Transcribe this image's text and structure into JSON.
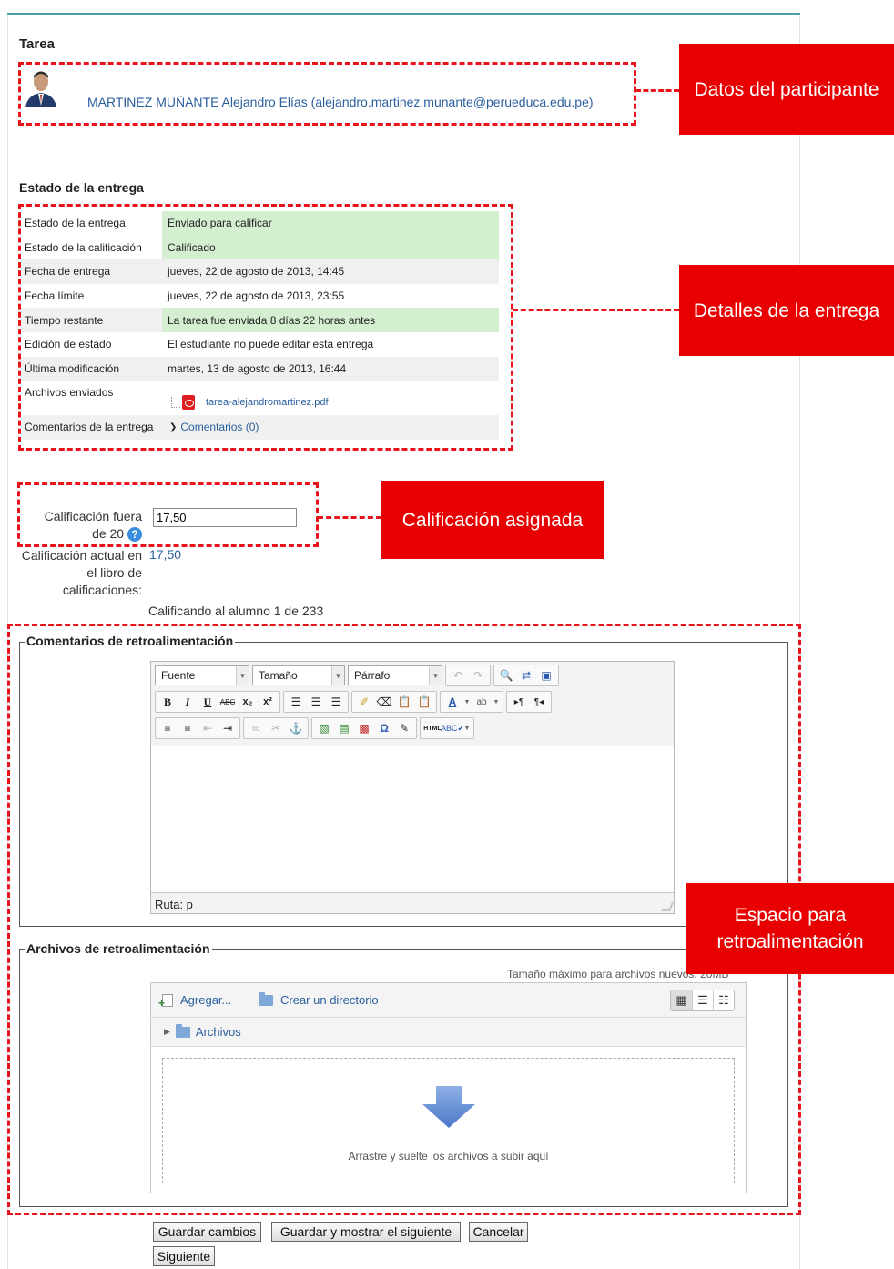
{
  "page": {
    "title": "Tarea"
  },
  "participant": {
    "name_email": "MARTINEZ MUÑANTE Alejandro Elías (alejandro.martinez.munante@perueduca.edu.pe)"
  },
  "callouts": {
    "participant": "Datos del participante",
    "details": "Detalles de la entrega",
    "grade": "Calificación asignada",
    "feedback": "Espacio para retroalimentación"
  },
  "submission": {
    "heading": "Estado de la entrega",
    "rows": [
      {
        "label": "Estado de la entrega",
        "value": "Enviado para calificar",
        "green": true
      },
      {
        "label": "Estado de la calificación",
        "value": "Calificado",
        "green": true
      },
      {
        "label": "Fecha de entrega",
        "value": "jueves, 22 de agosto de 2013, 14:45",
        "green": false
      },
      {
        "label": "Fecha límite",
        "value": "jueves, 22 de agosto de 2013, 23:55",
        "green": false
      },
      {
        "label": "Tiempo restante",
        "value": "La tarea fue enviada 8 días 22 horas antes",
        "green": true
      },
      {
        "label": "Edición de estado",
        "value": "El estudiante no puede editar esta entrega",
        "green": false
      },
      {
        "label": "Última modificación",
        "value": "martes, 13 de agosto de 2013, 16:44",
        "green": false
      }
    ],
    "files_label": "Archivos enviados",
    "file_name": "tarea-alejandromartinez.pdf",
    "comments_label": "Comentarios de la entrega",
    "comments_link": "Comentarios (0)"
  },
  "grade": {
    "label": "Calificación fuera de 20",
    "value": "17,50",
    "current_label": "Calificación actual en el libro de calificaciones:",
    "current_value": "17,50",
    "grading_count": "Calificando al alumno 1 de 233"
  },
  "feedback_comments": {
    "legend": "Comentarios de retroalimentación",
    "font_select": "Fuente",
    "size_select": "Tamaño",
    "format_select": "Párrafo",
    "path": "Ruta: p"
  },
  "feedback_files": {
    "legend": "Archivos de retroalimentación",
    "max_size": "Tamaño máximo para archivos nuevos: 20MB",
    "add": "Agregar...",
    "create_dir": "Crear un directorio",
    "folder": "Archivos",
    "drop_text": "Arrastre y suelte los archivos a subir aquí"
  },
  "buttons": {
    "save": "Guardar cambios",
    "save_next": "Guardar y mostrar el siguiente",
    "cancel": "Cancelar",
    "next": "Siguiente"
  },
  "colors": {
    "callout": "#e80000",
    "link": "#2a5f9e",
    "green_row": "#d3efd0"
  }
}
